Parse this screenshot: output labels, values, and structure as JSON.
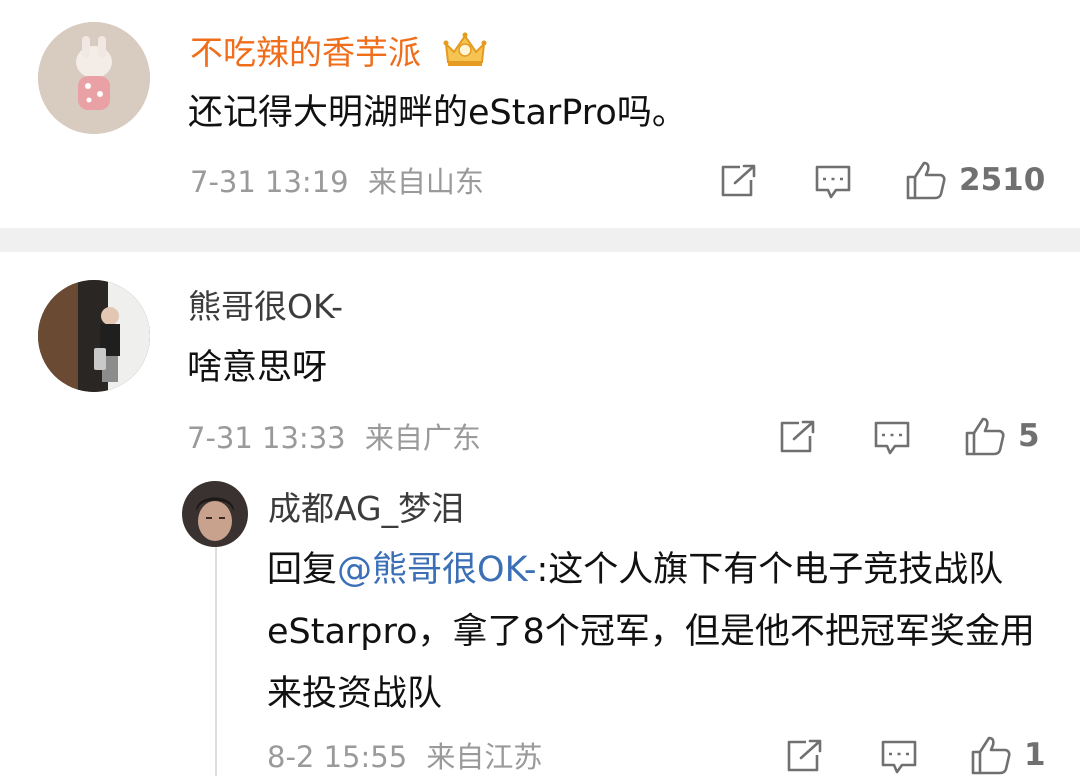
{
  "comment1": {
    "username": "不吃辣的香芋派",
    "badge_icon": "crown-badge-icon",
    "text": "还记得大明湖畔的eStarPro吗。",
    "time": "7-31 13:19",
    "location": "来自山东",
    "likes": "2510",
    "username_color": "#f06d1a"
  },
  "comment2": {
    "username": "熊哥很OK-",
    "text": "啥意思呀",
    "time": "7-31 13:33",
    "location": "来自广东",
    "likes": "5"
  },
  "reply": {
    "username": "成都AG_梦泪",
    "prefix": "回复",
    "mention": "@熊哥很OK-",
    "text": ":这个人旗下有个电子竞技战队eStarpro，拿了8个冠军，但是他不把冠军奖金用来投资战队",
    "time": "8-2 15:55",
    "location": "来自江苏",
    "likes": "1"
  },
  "colors": {
    "divider": "#f0f0f0",
    "mention": "#3b6fb6",
    "meta": "#9a9a9a"
  }
}
